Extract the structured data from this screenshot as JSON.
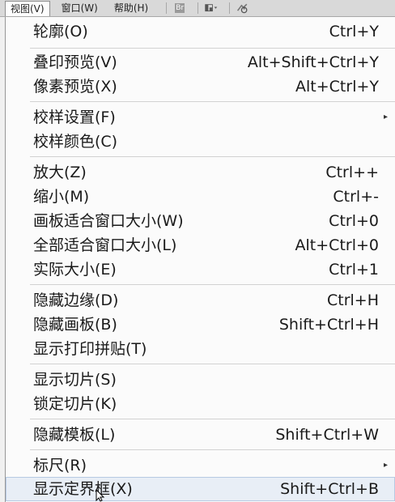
{
  "menubar": {
    "items": [
      "视图(V)",
      "窗口(W)",
      "帮助(H)"
    ],
    "br_icon": "Br"
  },
  "menu": {
    "items": [
      {
        "label": "轮廓(O)",
        "shortcut": "Ctrl+Y"
      },
      {
        "label": "叠印预览(V)",
        "shortcut": "Alt+Shift+Ctrl+Y"
      },
      {
        "label": "像素预览(X)",
        "shortcut": "Alt+Ctrl+Y"
      },
      {
        "label": "校样设置(F)",
        "shortcut": ""
      },
      {
        "label": "校样颜色(C)",
        "shortcut": ""
      },
      {
        "label": "放大(Z)",
        "shortcut": "Ctrl++"
      },
      {
        "label": "缩小(M)",
        "shortcut": "Ctrl+-"
      },
      {
        "label": "画板适合窗口大小(W)",
        "shortcut": "Ctrl+0"
      },
      {
        "label": "全部适合窗口大小(L)",
        "shortcut": "Alt+Ctrl+0"
      },
      {
        "label": "实际大小(E)",
        "shortcut": "Ctrl+1"
      },
      {
        "label": "隐藏边缘(D)",
        "shortcut": "Ctrl+H"
      },
      {
        "label": "隐藏画板(B)",
        "shortcut": "Shift+Ctrl+H"
      },
      {
        "label": "显示打印拼贴(T)",
        "shortcut": ""
      },
      {
        "label": "显示切片(S)",
        "shortcut": ""
      },
      {
        "label": "锁定切片(K)",
        "shortcut": ""
      },
      {
        "label": "隐藏模板(L)",
        "shortcut": "Shift+Ctrl+W"
      },
      {
        "label": "标尺(R)",
        "shortcut": ""
      },
      {
        "label": "显示定界框(X)",
        "shortcut": "Shift+Ctrl+B"
      }
    ]
  },
  "colors": {
    "highlight": "#e8eef6",
    "menu_bg": "#fbfbfb",
    "menubar_bg": "#d9d9d9"
  }
}
